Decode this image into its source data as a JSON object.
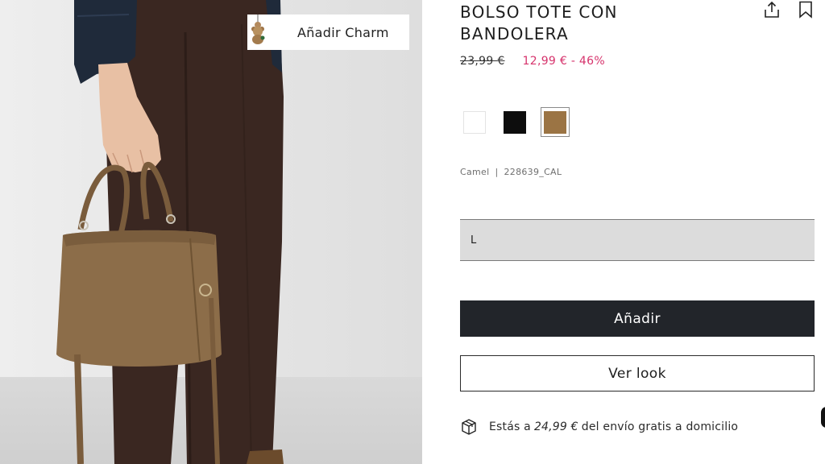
{
  "photo": {
    "charm_button_label": "Añadir Charm"
  },
  "product": {
    "title": "BOLSO TOTE CON BANDOLERA",
    "price_old": "23,99 €",
    "price_new": "12,99 € - 46%",
    "color_name": "Camel",
    "separator": "|",
    "reference": "228639_CAL",
    "swatches": [
      {
        "name": "Blanco",
        "color": "#ffffff"
      },
      {
        "name": "Negro",
        "color": "#0d0d0d"
      },
      {
        "name": "Camel",
        "color": "#9b7444",
        "selected": true
      }
    ],
    "size_selected": "L",
    "add_button_label": "Añadir",
    "look_button_label": "Ver look",
    "shipping": {
      "prefix": "Estás a",
      "amount": "24,99 €",
      "suffix": "del envío gratis a domicilio"
    }
  },
  "icons": {
    "share": "share-icon",
    "bookmark": "bookmark-icon",
    "shipping": "package-icon"
  },
  "colors": {
    "sale_price": "#d6336c",
    "primary_button": "#22252a"
  }
}
